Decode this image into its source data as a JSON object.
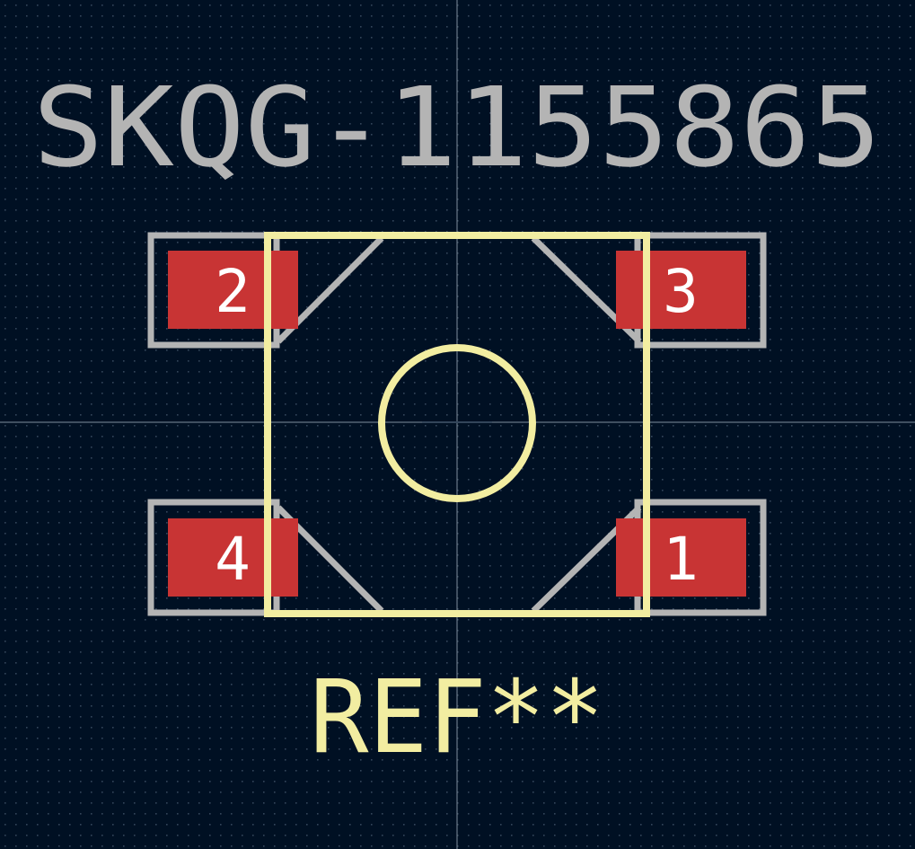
{
  "footprint": {
    "value_text": "SKQG-1155865",
    "reference_text": "REF**"
  },
  "pads": [
    {
      "number": "2"
    },
    {
      "number": "3"
    },
    {
      "number": "4"
    },
    {
      "number": "1"
    }
  ],
  "colors": {
    "background": "#001023",
    "grid_dot": "#3a4a5c",
    "crosshair": "#8a9aa8",
    "fab_layer": "#b4b4b4",
    "silkscreen": "#f2eda1",
    "pad_copper": "#c83434",
    "pad_number_text": "#ffffff"
  }
}
